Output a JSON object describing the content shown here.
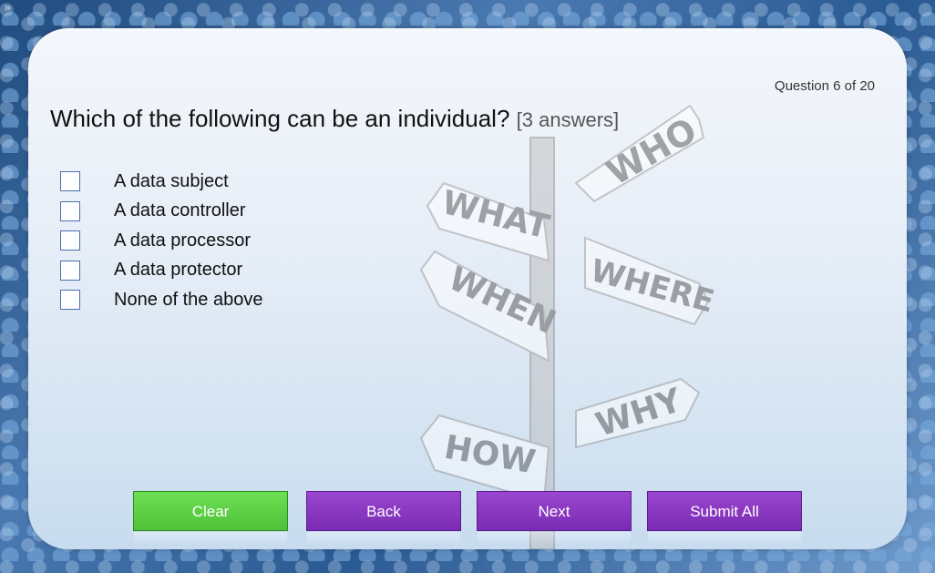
{
  "nav": {
    "collapse_icon_label": "»"
  },
  "quiz": {
    "counter": "Question 6 of 20",
    "question": "Which of the following can be an individual?",
    "hint": "[3 answers]",
    "options": [
      {
        "label": "A data subject",
        "checked": false
      },
      {
        "label": "A data controller",
        "checked": false
      },
      {
        "label": "A data processor",
        "checked": false
      },
      {
        "label": "A data protector",
        "checked": false
      },
      {
        "label": "None of the above",
        "checked": false
      }
    ]
  },
  "background_image": {
    "sign_labels": [
      "WHO",
      "WHAT",
      "WHERE",
      "WHEN",
      "WHY",
      "HOW"
    ]
  },
  "buttons": {
    "clear": "Clear",
    "back": "Back",
    "next": "Next",
    "submit_all": "Submit All"
  },
  "colors": {
    "clear_button": "#5fd248",
    "nav_buttons": "#8a38c2",
    "checkbox_border": "#4a6fb0"
  }
}
